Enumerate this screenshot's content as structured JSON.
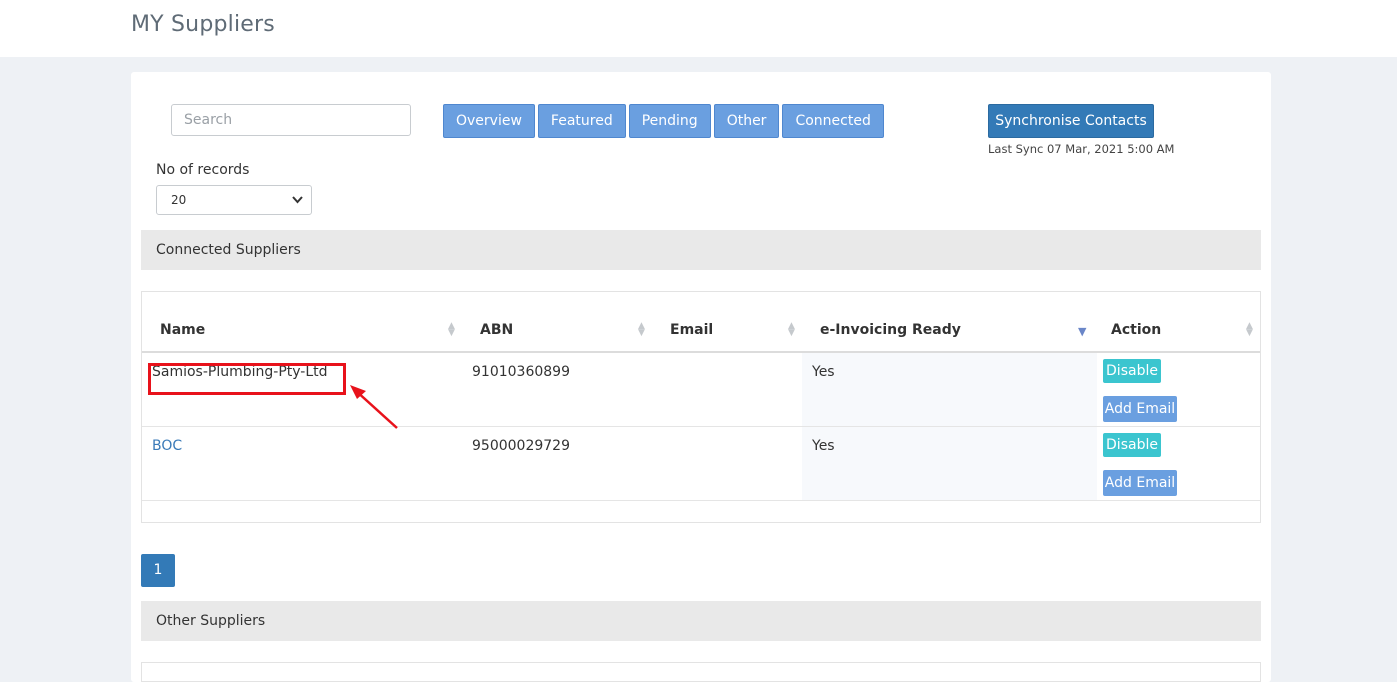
{
  "header": {
    "title": "MY Suppliers"
  },
  "search": {
    "placeholder": "Search"
  },
  "tabs": [
    {
      "label": "Overview"
    },
    {
      "label": "Featured"
    },
    {
      "label": "Pending"
    },
    {
      "label": "Other"
    },
    {
      "label": "Connected"
    }
  ],
  "sync": {
    "button_label": "Synchronise Contacts",
    "last_sync": "Last Sync 07 Mar, 2021 5:00 AM"
  },
  "records": {
    "label": "No of records",
    "selected": "20"
  },
  "connected": {
    "title": "Connected Suppliers",
    "columns": [
      "Name",
      "ABN",
      "Email",
      "e-Invoicing Ready",
      "Action"
    ],
    "rows": [
      {
        "name": "Samios-Plumbing-Pty-Ltd",
        "abn": "91010360899",
        "email": "",
        "einvoicing": "Yes",
        "action_primary": "Disable",
        "action_secondary": "Add Email"
      },
      {
        "name": "BOC",
        "abn": "95000029729",
        "email": "",
        "einvoicing": "Yes",
        "action_primary": "Disable",
        "action_secondary": "Add Email"
      }
    ],
    "sorted_column": "e-Invoicing Ready"
  },
  "pagination": {
    "current_page": "1"
  },
  "other": {
    "title": "Other Suppliers"
  },
  "colors": {
    "tab_bg": "#6a9fe0",
    "primary": "#337ab7",
    "disable_button": "#3bc5cf",
    "highlight": "#e8121b"
  }
}
